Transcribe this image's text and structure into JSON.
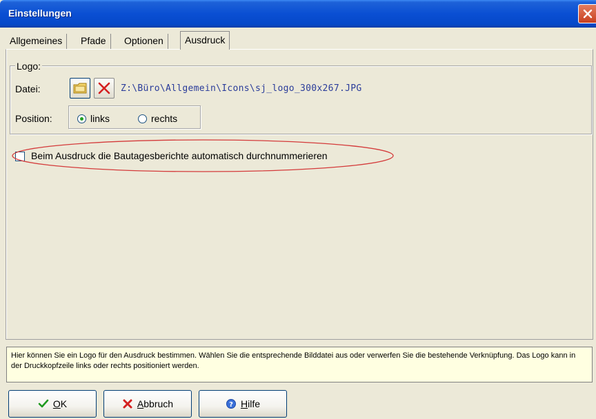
{
  "window": {
    "title": "Einstellungen"
  },
  "tabs": [
    {
      "label": "Allgemeines"
    },
    {
      "label": "Pfade"
    },
    {
      "label": "Optionen"
    },
    {
      "label": "Ausdruck",
      "active": true
    }
  ],
  "logo_group": {
    "legend": "Logo:",
    "file_label": "Datei:",
    "file_path": "Z:\\Büro\\Allgemein\\Icons\\sj_logo_300x267.JPG",
    "position_label": "Position:",
    "position_options": [
      {
        "label": "links",
        "checked": true
      },
      {
        "label": "rechts",
        "checked": false
      }
    ]
  },
  "auto_number": {
    "label": "Beim Ausdruck die Bautagesberichte automatisch durchnummerieren",
    "checked": false
  },
  "hint": {
    "text": "Hier können Sie ein Logo für den Ausdruck bestimmen. Wählen Sie die entsprechende Bilddatei aus oder verwerfen Sie die bestehende Verknüpfung. Das Logo kann in der Druckkopfzeile links oder rechts positioniert werden."
  },
  "buttons": {
    "ok": {
      "mnemonic": "O",
      "rest": "K"
    },
    "cancel": {
      "mnemonic": "A",
      "rest": "bbruch"
    },
    "help": {
      "mnemonic": "H",
      "rest": "ilfe"
    }
  },
  "icons": [
    "folder-icon",
    "delete-x-icon",
    "close-icon",
    "checkmark-icon",
    "cancel-x-icon",
    "help-icon"
  ],
  "colors": {
    "titlebar": "#0a4fd3",
    "hint_bg": "#ffffe1",
    "path_text": "#2a3c9a",
    "highlight_ellipse": "#d43a3a"
  }
}
